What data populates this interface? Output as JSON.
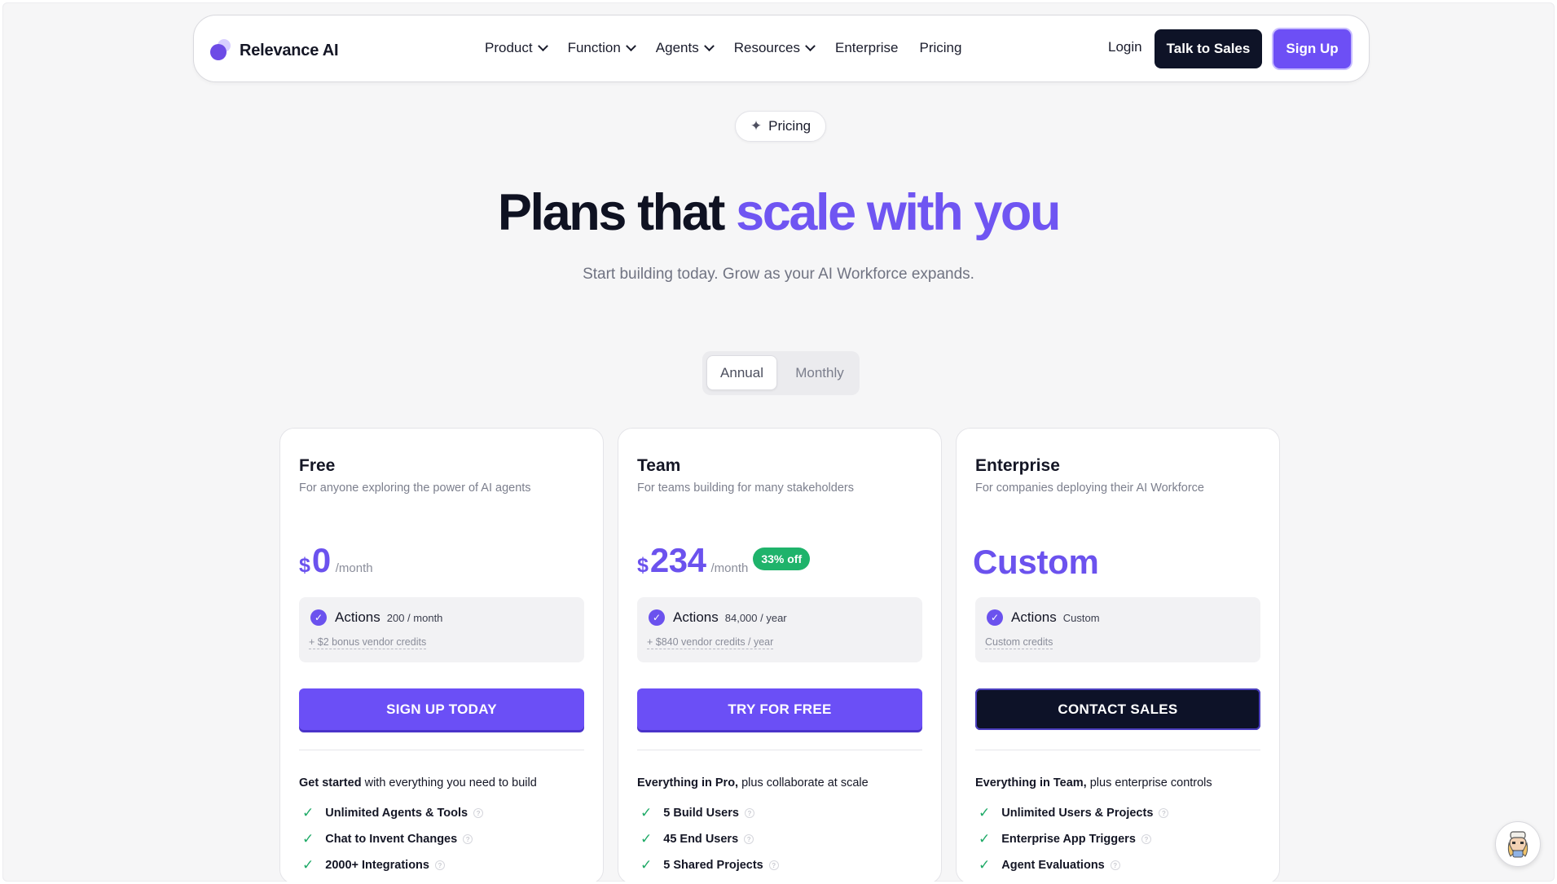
{
  "nav": {
    "brand": "Relevance AI",
    "menu": [
      {
        "label": "Product",
        "dropdown": true
      },
      {
        "label": "Function",
        "dropdown": true
      },
      {
        "label": "Agents",
        "dropdown": true
      },
      {
        "label": "Resources",
        "dropdown": true
      },
      {
        "label": "Enterprise",
        "dropdown": false
      },
      {
        "label": "Pricing",
        "dropdown": false
      }
    ],
    "login": "Login",
    "talk_to_sales": "Talk to Sales",
    "sign_up": "Sign Up"
  },
  "hero": {
    "pill": "Pricing",
    "title_main": "Plans that ",
    "title_accent": "scale with you",
    "subtitle": "Start building today. Grow as your AI Workforce expands."
  },
  "billing_toggle": {
    "options": [
      "Annual",
      "Monthly"
    ],
    "selected": "Annual"
  },
  "plans": [
    {
      "name": "Free",
      "description": "For anyone exploring the power of AI agents",
      "currency": "$",
      "price": "0",
      "period": "/month",
      "actions_label": "Actions",
      "actions_qty": "200 / month",
      "credits": "+ $2 bonus vendor credits",
      "cta": "SIGN UP TODAY",
      "features_head_bold": "Get started",
      "features_head_rest": " with everything you need to build",
      "features": [
        "Unlimited Agents & Tools",
        "Chat to Invent Changes",
        "2000+ Integrations"
      ]
    },
    {
      "name": "Team",
      "description": "For teams building for many stakeholders",
      "currency": "$",
      "price": "234",
      "period": "/month",
      "badge": "33% off",
      "actions_label": "Actions",
      "actions_qty": "84,000 / year",
      "credits": "+ $840 vendor credits / year",
      "cta": "TRY FOR FREE",
      "features_head_bold": "Everything in Pro,",
      "features_head_rest": " plus collaborate at scale",
      "features": [
        "5 Build Users",
        "45 End Users",
        "5 Shared Projects"
      ]
    },
    {
      "name": "Enterprise",
      "description": "For companies deploying their AI Workforce",
      "price_custom": "Custom",
      "actions_label": "Actions",
      "actions_qty": "Custom",
      "credits": "Custom credits",
      "cta": "CONTACT SALES",
      "features_head_bold": "Everything in Team,",
      "features_head_rest": " plus enterprise controls",
      "features": [
        "Unlimited Users & Projects",
        "Enterprise App Triggers",
        "Agent Evaluations"
      ]
    }
  ],
  "colors": {
    "accent": "#6b52ee",
    "dark": "#0e1327",
    "success": "#1fb36b"
  },
  "icons": {
    "logo": "relevance-logo-icon",
    "pill": "sparkle-icon",
    "check": "check-icon",
    "info": "info-icon",
    "chat": "chat-avatar-icon"
  }
}
